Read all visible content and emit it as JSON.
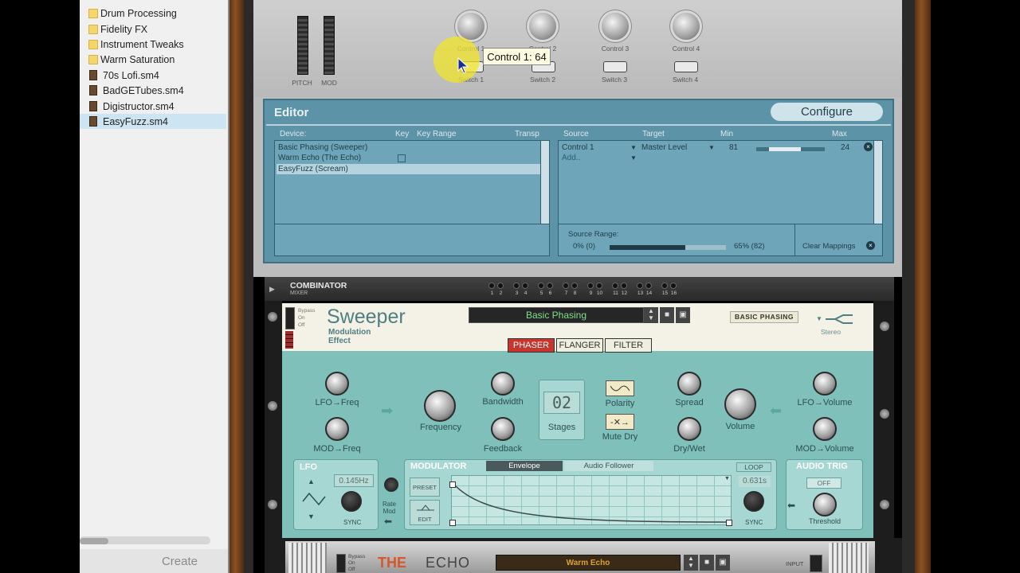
{
  "browser": {
    "items": [
      {
        "label": "Drum Processing",
        "type": "folder",
        "selected": false
      },
      {
        "label": "Fidelity FX",
        "type": "folder",
        "selected": false
      },
      {
        "label": "Instrument Tweaks",
        "type": "folder",
        "selected": false
      },
      {
        "label": "Warm Saturation",
        "type": "folder",
        "selected": false
      },
      {
        "label": "70s Lofi.sm4",
        "type": "file",
        "selected": false
      },
      {
        "label": "BadGETubes.sm4",
        "type": "file",
        "selected": false
      },
      {
        "label": "Digistructor.sm4",
        "type": "file",
        "selected": false
      },
      {
        "label": "EasyFuzz.sm4",
        "type": "file",
        "selected": true
      }
    ],
    "create_label": "Create"
  },
  "wheels": {
    "pitch": "PITCH",
    "mod": "MOD"
  },
  "controls": {
    "knobs": [
      "Control 1",
      "Control 2",
      "Control 3",
      "Control 4"
    ],
    "switches": [
      "Switch 1",
      "Switch 2",
      "Switch 3",
      "Switch 4"
    ],
    "tooltip": "Control 1: 64"
  },
  "editor": {
    "title": "Editor",
    "configure_label": "Configure",
    "device_headers": {
      "device": "Device:",
      "key": "Key",
      "key_range": "Key Range",
      "transp": "Transp"
    },
    "devices": [
      "Basic Phasing (Sweeper)",
      "Warm Echo (The Echo)",
      "EasyFuzz (Scream)"
    ],
    "selected_device_index": 2,
    "mapping_headers": {
      "source": "Source",
      "target": "Target",
      "min": "Min",
      "max": "Max"
    },
    "mappings": [
      {
        "source": "Control 1",
        "target": "Master Level",
        "min": "81",
        "max": "24"
      }
    ],
    "add_label": "Add..",
    "source_range_label": "Source Range:",
    "source_range_min": "0% (0)",
    "source_range_max": "65% (82)",
    "clear_label": "Clear Mappings"
  },
  "combinator": {
    "title": "COMBINATOR",
    "subtitle": "MIXER",
    "channels": [
      "1",
      "2",
      "3",
      "4",
      "5",
      "6",
      "7",
      "8",
      "9",
      "10",
      "11",
      "12",
      "13",
      "14",
      "15",
      "16"
    ]
  },
  "sweeper": {
    "bypass": "Bypass",
    "on": "On",
    "off": "Off",
    "name": "Sweeper",
    "subtitle_1": "Modulation",
    "subtitle_2": "Effect",
    "patch": "Basic Phasing",
    "tape_label": "BASIC PHASING",
    "stereo": "Stereo",
    "modes": [
      "PHASER",
      "FLANGER",
      "FILTER"
    ],
    "active_mode": "PHASER",
    "labels": {
      "lfo_freq": "LFO→Freq",
      "mod_freq": "MOD→Freq",
      "frequency": "Frequency",
      "bandwidth": "Bandwidth",
      "feedback": "Feedback",
      "stages": "Stages",
      "stages_value": "02",
      "polarity": "Polarity",
      "mute_dry": "Mute Dry",
      "spread": "Spread",
      "dry_wet": "Dry/Wet",
      "volume": "Volume",
      "lfo_volume": "LFO→Volume",
      "mod_volume": "MOD→Volume"
    },
    "lfo": {
      "title": "LFO",
      "rate": "0.145Hz",
      "sync": "SYNC",
      "rate_mod_1": "Rate",
      "rate_mod_2": "Mod"
    },
    "modulator": {
      "title": "MODULATOR",
      "tabs": [
        "Envelope",
        "Audio Follower"
      ],
      "active_tab": "Envelope",
      "preset": "PRESET",
      "edit": "EDIT",
      "loop": "LOOP",
      "time": "0.631s",
      "sync": "SYNC"
    },
    "audio_trig": {
      "title": "AUDIO TRIG",
      "state": "OFF",
      "threshold": "Threshold"
    }
  },
  "echo": {
    "bypass": "Bypass",
    "on": "On",
    "off": "Off",
    "logo_1": "THE",
    "logo_2": "ECHO",
    "patch": "Warm Echo",
    "input": "INPUT"
  }
}
